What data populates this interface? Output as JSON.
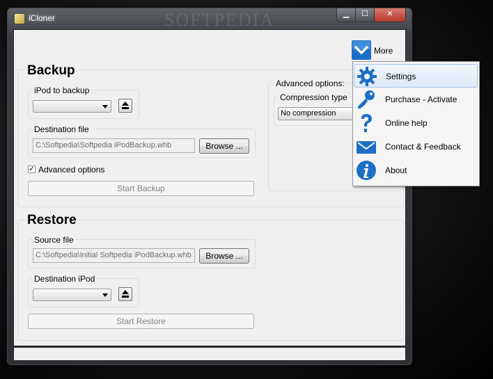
{
  "window": {
    "title": "iCloner",
    "watermark": "SOFTPEDIA",
    "min_glyph": "▁",
    "max_glyph": "☐",
    "close_glyph": "✕"
  },
  "backup": {
    "title": "Backup",
    "ipod_label": "iPod to backup",
    "destination_label": "Destination file",
    "destination_value": "C:\\Softpedia\\Softpedia iPodBackup.whb",
    "browse_label": "Browse ...",
    "advanced_checkbox_label": "Advanced options",
    "advanced_checked": true,
    "start_label": "Start Backup"
  },
  "advanced": {
    "title": "Advanced options:",
    "compression_label": "Compression type",
    "compression_value": "No compression"
  },
  "restore": {
    "title": "Restore",
    "source_label": "Source file",
    "source_value": "C:\\Softpedia\\Initial Softpedia iPodBackup.whb",
    "browse_label": "Browse ...",
    "destination_label": "Destination iPod",
    "start_label": "Start Restore"
  },
  "more": {
    "label": "More"
  },
  "menu": {
    "items": [
      {
        "label": "Settings",
        "icon": "gear-icon"
      },
      {
        "label": "Purchase - Activate",
        "icon": "key-icon"
      },
      {
        "label": "Online help",
        "icon": "question-icon"
      },
      {
        "label": "Contact & Feedback",
        "icon": "envelope-icon"
      },
      {
        "label": "About",
        "icon": "info-icon"
      }
    ]
  },
  "colors": {
    "accent_blue": "#1c6fc4",
    "menu_highlight": "#dde9fa"
  }
}
